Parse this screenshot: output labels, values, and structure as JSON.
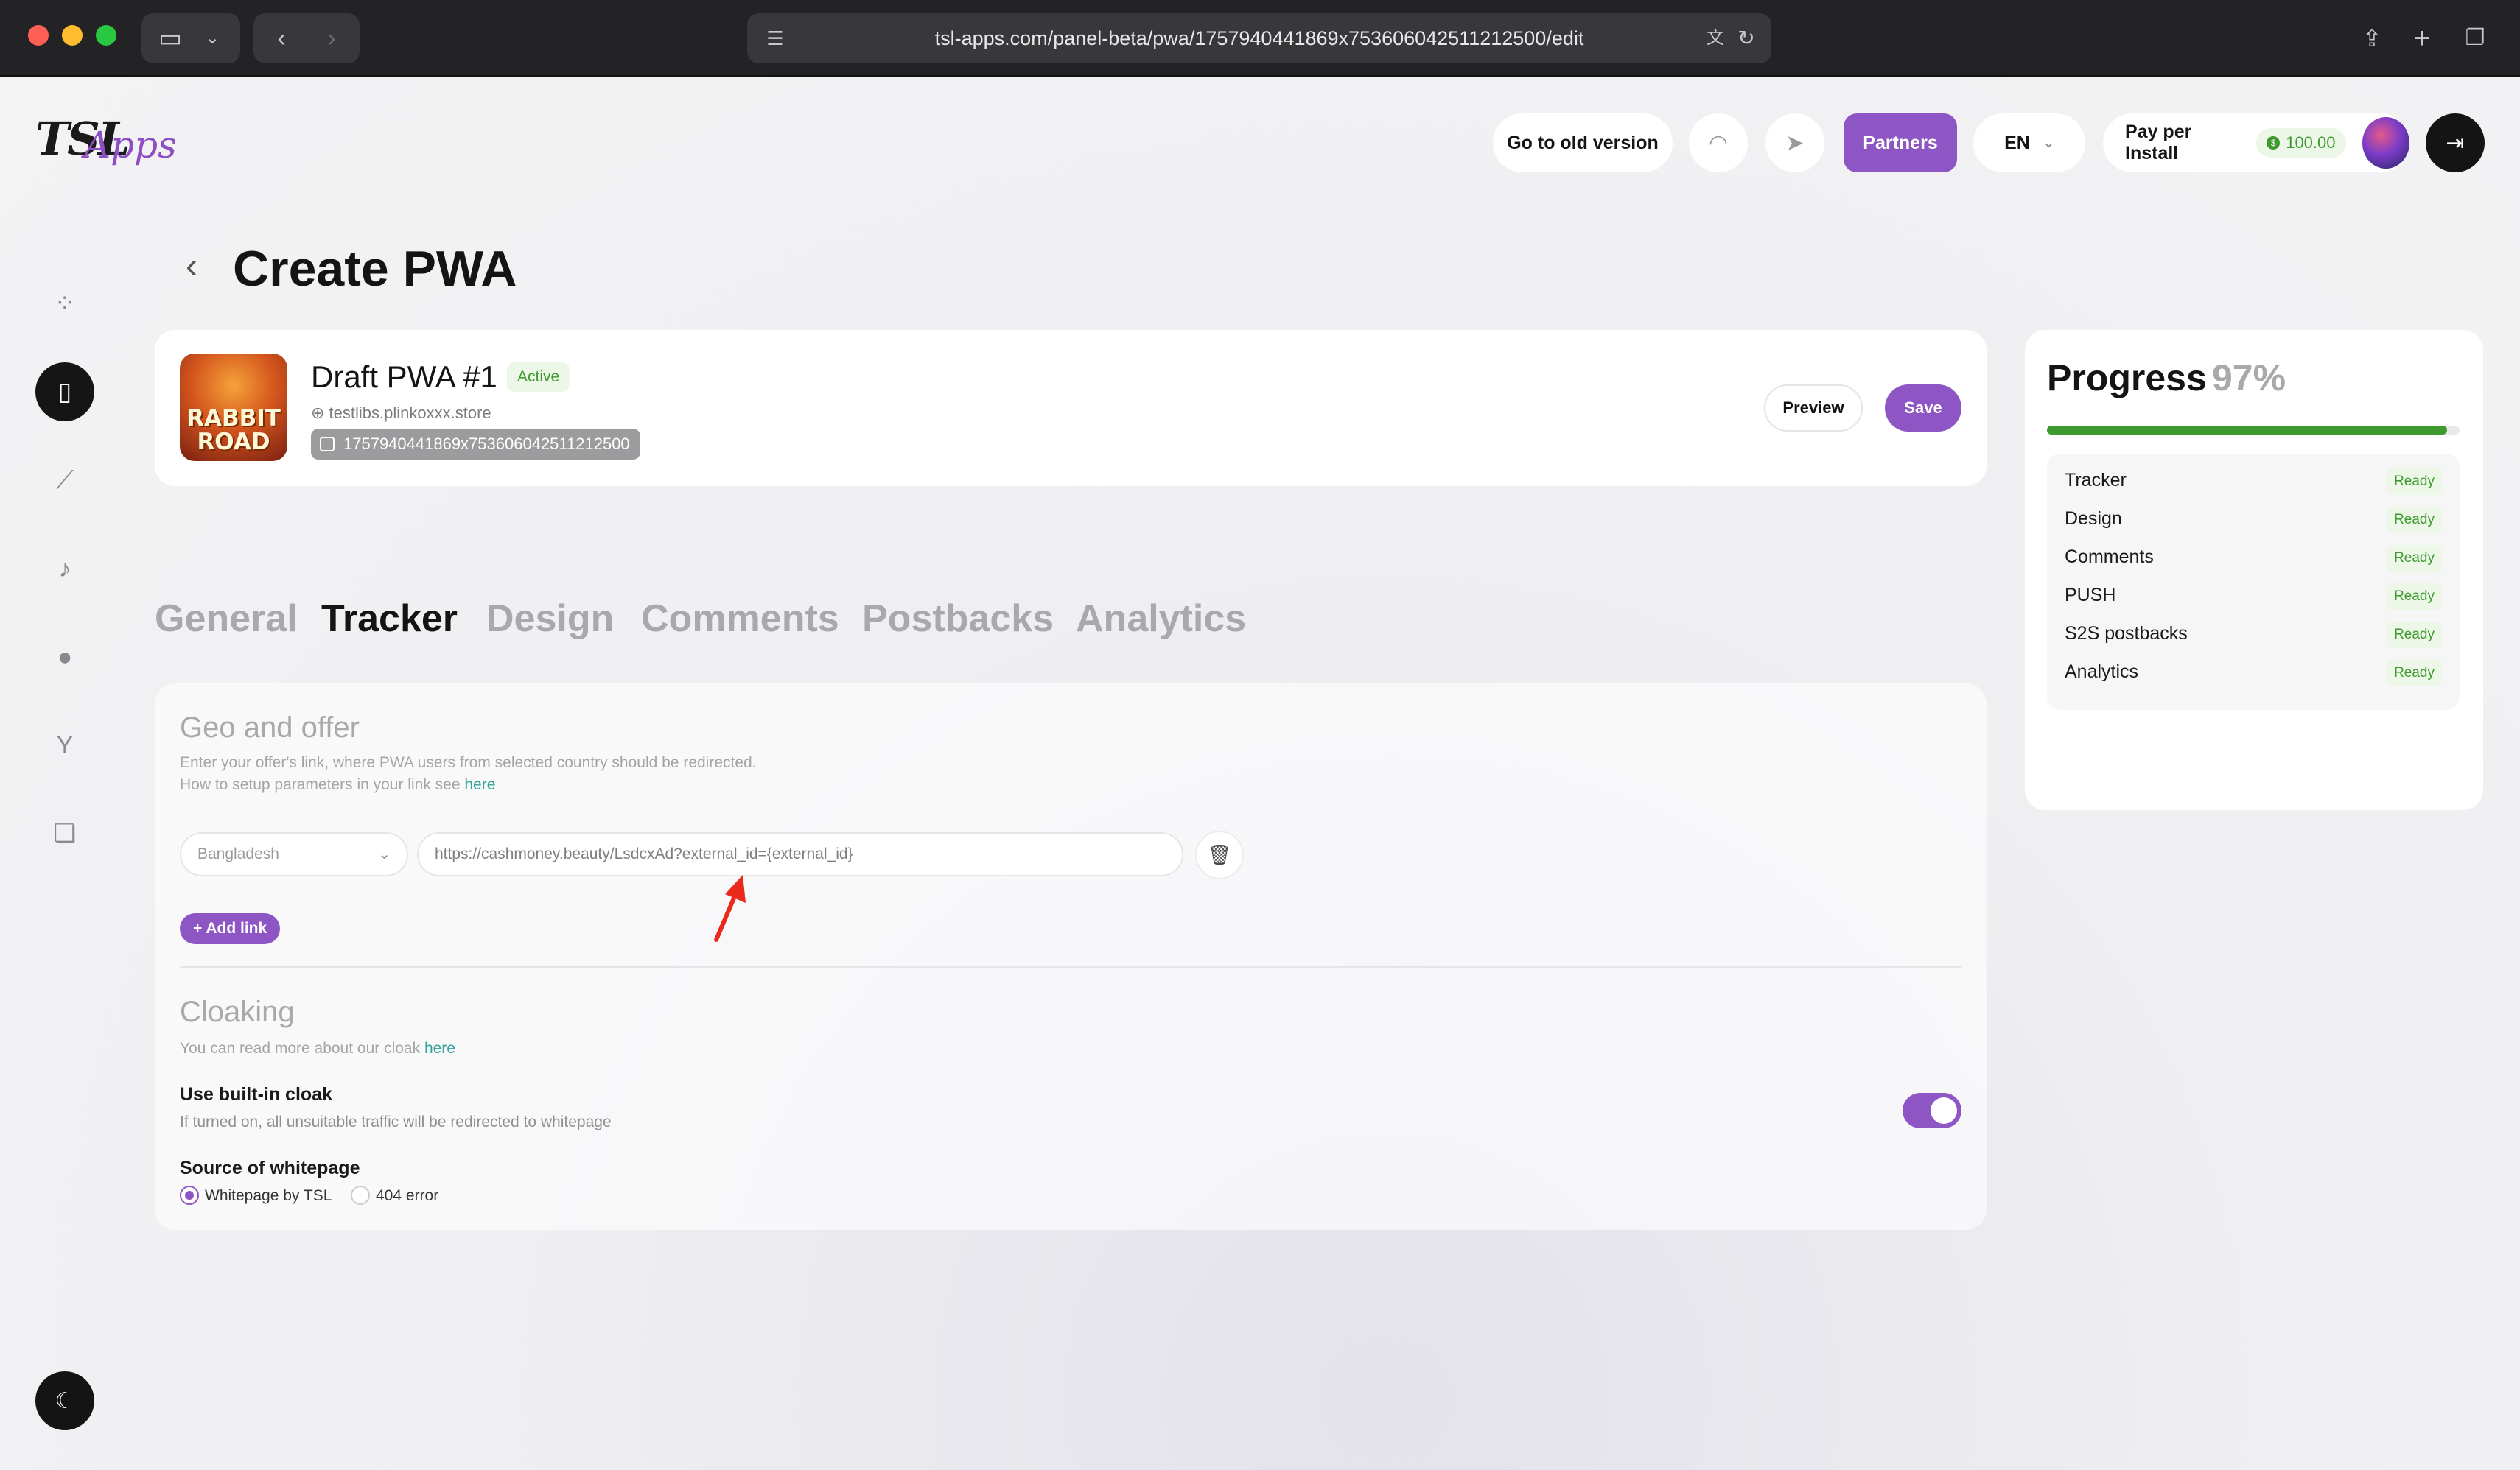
{
  "browser": {
    "url": "tsl-apps.com/panel-beta/pwa/1757940441869x753606042511212500/edit"
  },
  "brand": {
    "logo_main": "TSL",
    "logo_sub": "Apps"
  },
  "header": {
    "old_version": "Go to old version",
    "partners": "Partners",
    "language": "EN",
    "pay_mode": "Pay per Install",
    "balance": "100.00"
  },
  "page": {
    "title": "Create PWA"
  },
  "app": {
    "name": "Draft PWA #1",
    "status": "Active",
    "domain": "testlibs.plinkoxxx.store",
    "id": "1757940441869x753606042511212500",
    "icon_text_1": "RABBIT",
    "icon_text_2": "ROAD",
    "preview_label": "Preview",
    "save_label": "Save"
  },
  "tabs": [
    {
      "label": "General"
    },
    {
      "label": "Tracker"
    },
    {
      "label": "Design"
    },
    {
      "label": "Comments"
    },
    {
      "label": "Postbacks"
    },
    {
      "label": "Analytics"
    }
  ],
  "active_tab": "Tracker",
  "geo": {
    "title": "Geo and offer",
    "desc1": "Enter your offer's link, where PWA users from selected country should be redirected.",
    "desc2": "How to setup parameters in your link see",
    "desc2_link": "here",
    "country": "Bangladesh",
    "url": "https://cashmoney.beauty/LsdcxAd?external_id={external_id}",
    "add_link": "Add link"
  },
  "cloaking": {
    "title": "Cloaking",
    "desc": "You can read more about our cloak",
    "desc_link": "here",
    "builtin_title": "Use built-in cloak",
    "builtin_desc": "If turned on, all unsuitable traffic will be redirected to whitepage",
    "builtin_on": true,
    "source_title": "Source of whitepage",
    "options": [
      {
        "label": "Whitepage by TSL",
        "selected": true
      },
      {
        "label": "404 error",
        "selected": false
      }
    ]
  },
  "progress": {
    "title": "Progress",
    "percent_label": "97%",
    "percent": 97,
    "items": [
      {
        "label": "Tracker",
        "status": "Ready"
      },
      {
        "label": "Design",
        "status": "Ready"
      },
      {
        "label": "Comments",
        "status": "Ready"
      },
      {
        "label": "PUSH",
        "status": "Ready"
      },
      {
        "label": "S2S postbacks",
        "status": "Ready"
      },
      {
        "label": "Analytics",
        "status": "Ready"
      }
    ]
  },
  "colors": {
    "accent": "#8e56c5",
    "success": "#3e9a2f",
    "link": "#33a39a",
    "annotation": "#e8291c"
  }
}
